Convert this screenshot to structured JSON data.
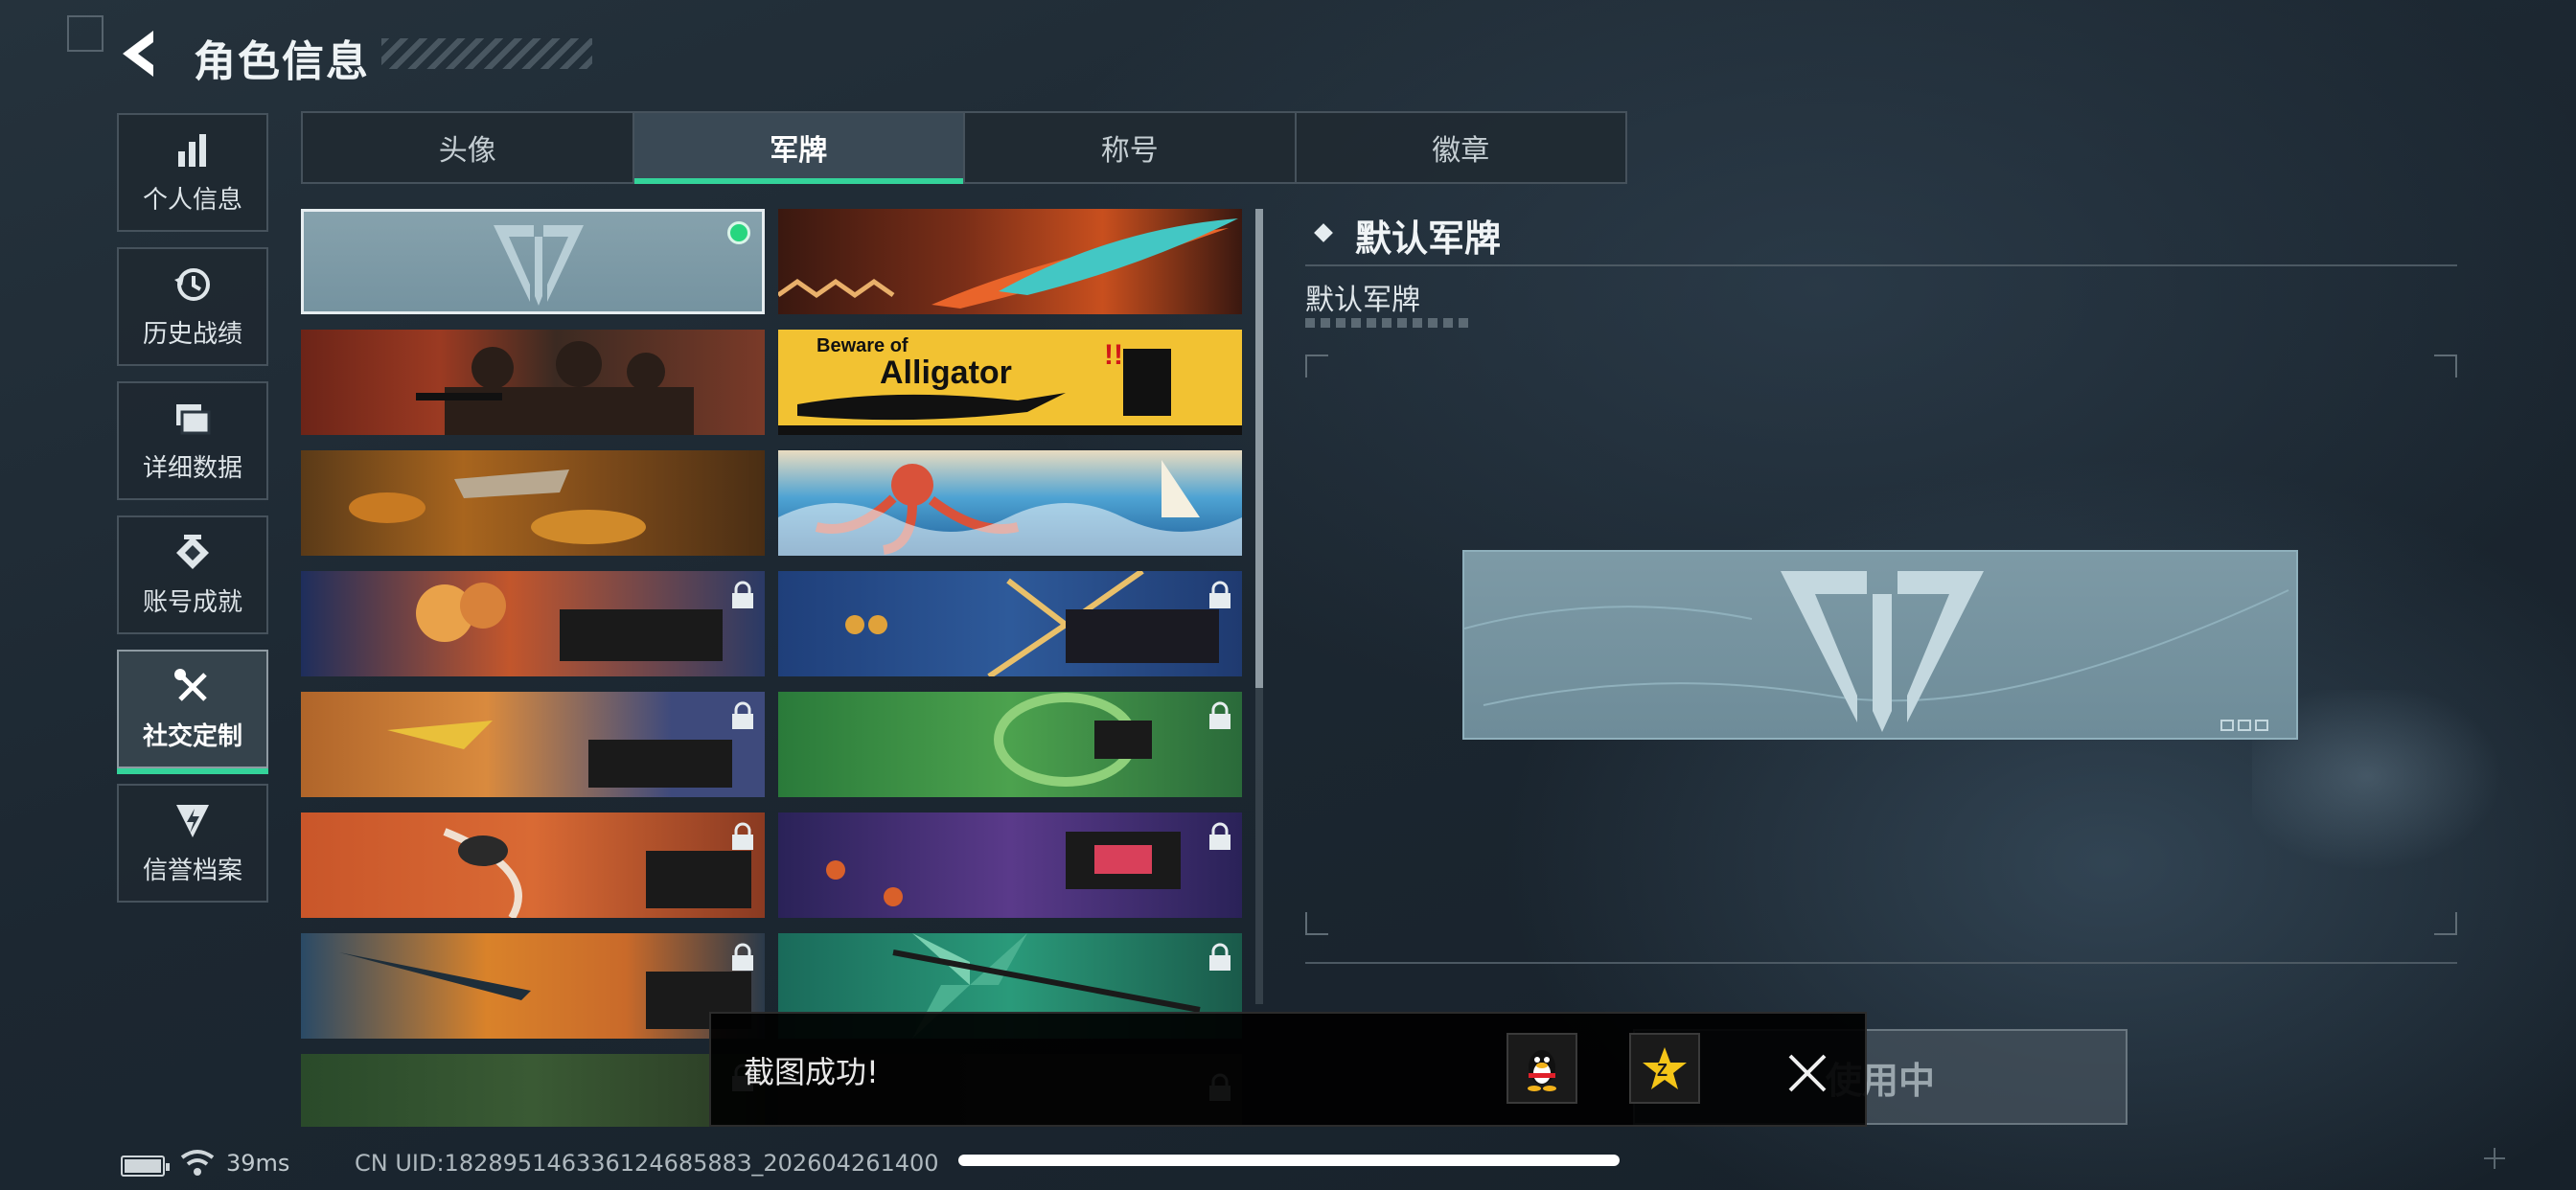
{
  "header": {
    "title": "角色信息"
  },
  "sidebar": {
    "items": [
      {
        "label": "个人信息",
        "icon": "bar-chart-icon",
        "active": false
      },
      {
        "label": "历史战绩",
        "icon": "history-clock-icon",
        "active": false
      },
      {
        "label": "详细数据",
        "icon": "folder-icon",
        "active": false
      },
      {
        "label": "账号成就",
        "icon": "achievement-medal-icon",
        "active": false
      },
      {
        "label": "社交定制",
        "icon": "wrench-screwdriver-icon",
        "active": true
      },
      {
        "label": "信誉档案",
        "icon": "credit-shield-icon",
        "active": false
      }
    ]
  },
  "tabs": [
    {
      "label": "头像",
      "active": false
    },
    {
      "label": "军牌",
      "active": true
    },
    {
      "label": "称号",
      "active": false
    },
    {
      "label": "徽章",
      "active": false
    }
  ],
  "plates": [
    {
      "theme": "default-logo",
      "selected": true,
      "locked": false
    },
    {
      "theme": "tribal-feather",
      "selected": false,
      "locked": false
    },
    {
      "theme": "soldiers-squad",
      "selected": false,
      "locked": false
    },
    {
      "theme": "beware-of-alligator",
      "selected": false,
      "locked": false,
      "text_line1": "Beware of",
      "text_line2": "Alligator"
    },
    {
      "theme": "autumn-leaves",
      "selected": false,
      "locked": false
    },
    {
      "theme": "octopus-wave",
      "selected": false,
      "locked": false
    },
    {
      "theme": "explosion-blaster",
      "selected": false,
      "locked": true
    },
    {
      "theme": "blue-blast",
      "selected": false,
      "locked": true
    },
    {
      "theme": "orange-ship",
      "selected": false,
      "locked": true
    },
    {
      "theme": "green-vortex",
      "selected": false,
      "locked": true
    },
    {
      "theme": "orange-swirl",
      "selected": false,
      "locked": true
    },
    {
      "theme": "purple-pawprint",
      "selected": false,
      "locked": true
    },
    {
      "theme": "orange-knife",
      "selected": false,
      "locked": true
    },
    {
      "theme": "teal-pinwheel",
      "selected": false,
      "locked": true
    },
    {
      "theme": "green-camo",
      "selected": false,
      "locked": true
    },
    {
      "theme": "dark-partial",
      "selected": false,
      "locked": true
    }
  ],
  "detail": {
    "heading": "默认军牌",
    "name": "默认军牌",
    "button_label": "使用中"
  },
  "toast": {
    "message": "截图成功!",
    "share_qq_icon": "qq-penguin-icon",
    "share_qzone_icon": "qzone-star-icon",
    "close_icon": "close-icon"
  },
  "status": {
    "ping": "39ms",
    "uid": "CN UID:18289514633612468588З_202604261400"
  },
  "colors": {
    "accent_green": "#34d39a",
    "selected_dot": "#27d67f",
    "plate_default": "#7d9aa6"
  }
}
